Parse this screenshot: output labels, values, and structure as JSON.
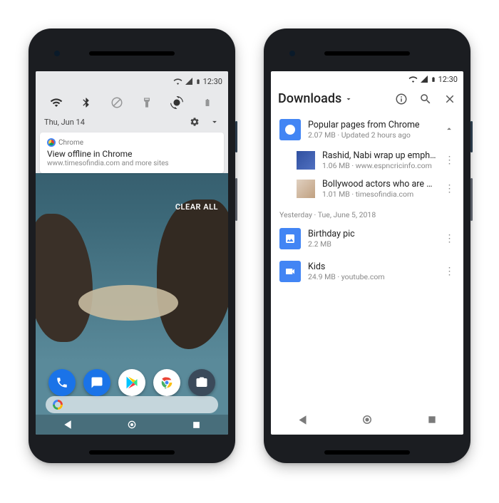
{
  "status_time": "12:30",
  "left": {
    "shade_date": "Thu, Jun 14",
    "notif_app": "Chrome",
    "notif_title": "View offline in Chrome",
    "notif_sub": "www.timesofindia.com and more sites",
    "clear_all": "CLEAR ALL"
  },
  "right": {
    "header_title": "Downloads",
    "group": {
      "title": "Popular pages from Chrome",
      "sub": "2.07 MB · Updated 2 hours ago"
    },
    "sub_items": [
      {
        "title": "Rashid, Nabi wrap up emph...",
        "sub": "1.06 MB · www.espncricinfo.com"
      },
      {
        "title": "Bollywood actors who are d...",
        "sub": "1.01 MB · timesofindia.com"
      }
    ],
    "section_label": "Yesterday · Tue, June 5, 2018",
    "items": [
      {
        "title": "Birthday pic",
        "sub": "2.2 MB",
        "icon": "image"
      },
      {
        "title": "Kids",
        "sub": "24.9 MB · youtube.com",
        "icon": "video"
      }
    ]
  }
}
